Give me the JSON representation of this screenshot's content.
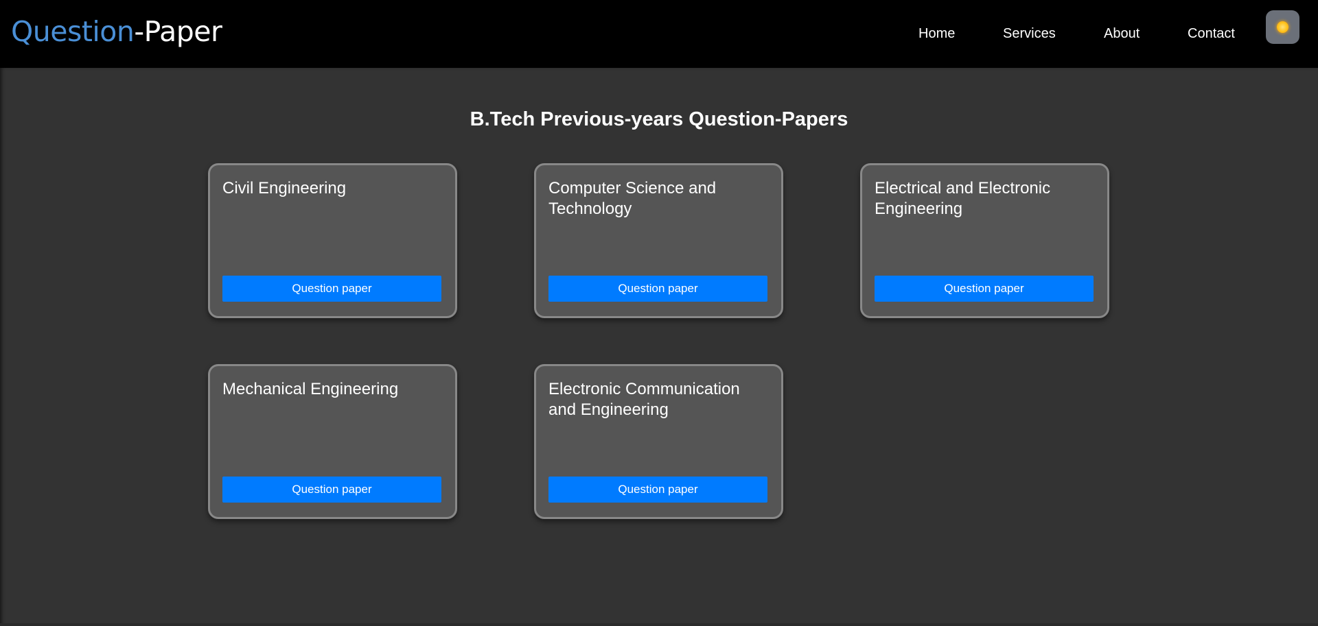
{
  "header": {
    "logo_part_a": "Question",
    "logo_part_b": "-Paper",
    "nav": [
      {
        "label": "Home"
      },
      {
        "label": "Services"
      },
      {
        "label": "About"
      },
      {
        "label": "Contact"
      }
    ],
    "theme_toggle_icon": "sun-icon"
  },
  "main": {
    "title": "B.Tech Previous-years Question-Papers",
    "cards": [
      {
        "title": "Civil Engineering",
        "button_label": "Question paper"
      },
      {
        "title": "Computer Science and Technology",
        "button_label": "Question paper"
      },
      {
        "title": "Electrical and Electronic Engineering",
        "button_label": "Question paper"
      },
      {
        "title": "Mechanical Engineering",
        "button_label": "Question paper"
      },
      {
        "title": "Electronic Communication and Engineering",
        "button_label": "Question paper"
      }
    ]
  },
  "colors": {
    "header_bg": "#000000",
    "page_bg": "#333333",
    "card_bg": "#555555",
    "card_border": "#888888",
    "button_bg": "#007bff",
    "logo_accent": "#4a8fd6"
  }
}
